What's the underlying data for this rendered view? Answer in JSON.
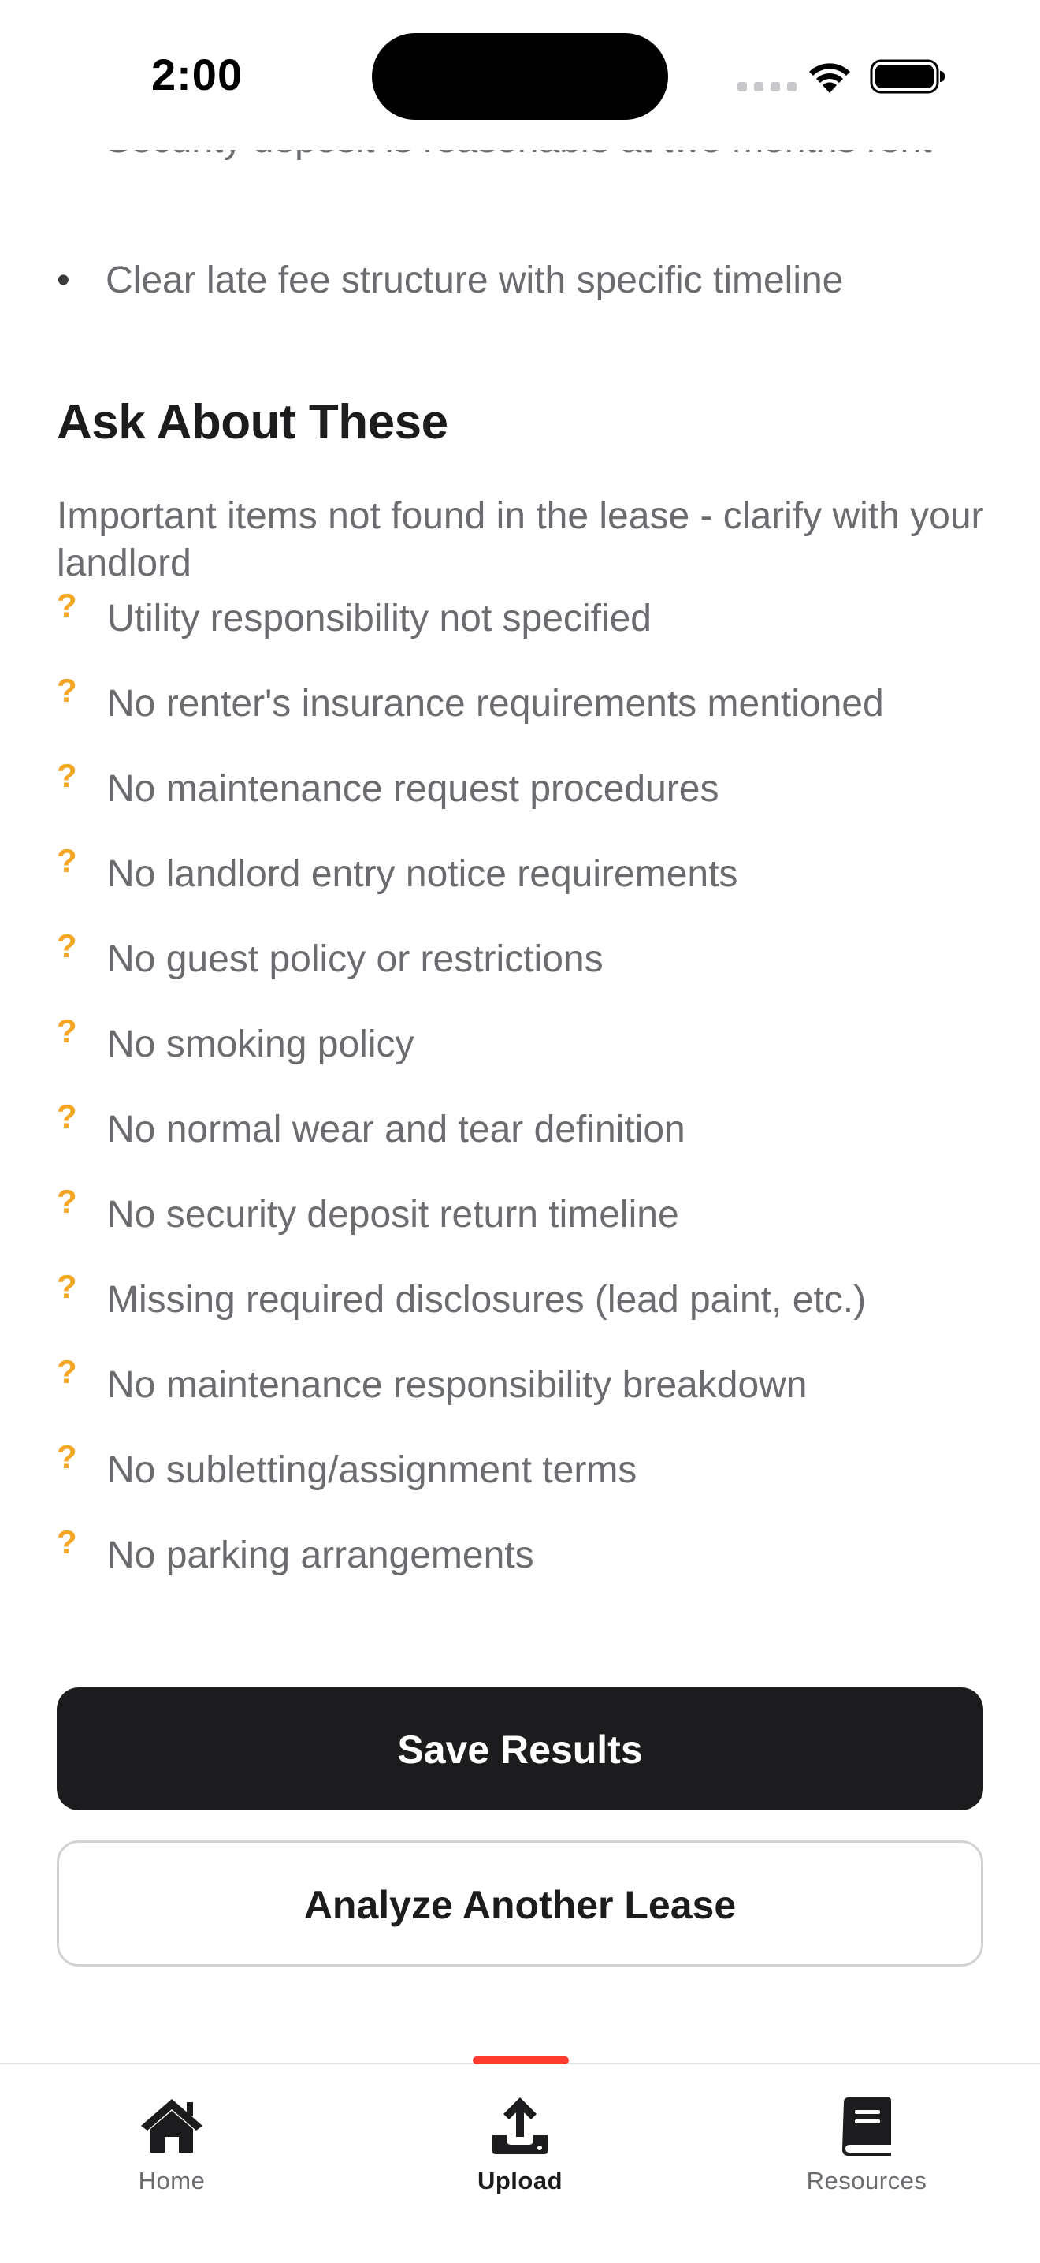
{
  "status_bar": {
    "time": "2:00"
  },
  "previous_section": {
    "bullets": [
      {
        "bullet": "•",
        "text": "Security deposit is reasonable at two months rent"
      },
      {
        "bullet": "•",
        "text": "Clear late fee structure with specific timeline"
      }
    ]
  },
  "ask_section": {
    "title": "Ask About These",
    "subtitle": "Important items not found in the lease - clarify with your landlord",
    "icon_glyph": "?",
    "icon_color": "#f5a623",
    "items": [
      "Utility responsibility not specified",
      "No renter's insurance requirements mentioned",
      "No maintenance request procedures",
      "No landlord entry notice requirements",
      "No guest policy or restrictions",
      "No smoking policy",
      "No normal wear and tear definition",
      "No security deposit return timeline",
      "Missing required disclosures (lead paint, etc.)",
      "No maintenance responsibility breakdown",
      "No subletting/assignment terms",
      "No parking arrangements"
    ]
  },
  "actions": {
    "save_label": "Save Results",
    "analyze_label": "Analyze Another Lease"
  },
  "tab_bar": {
    "active_indicator_color": "#ff3b30",
    "tabs": [
      {
        "label": "Home",
        "icon": "home-icon",
        "active": false
      },
      {
        "label": "Upload",
        "icon": "upload-icon",
        "active": true
      },
      {
        "label": "Resources",
        "icon": "book-icon",
        "active": false
      }
    ]
  }
}
